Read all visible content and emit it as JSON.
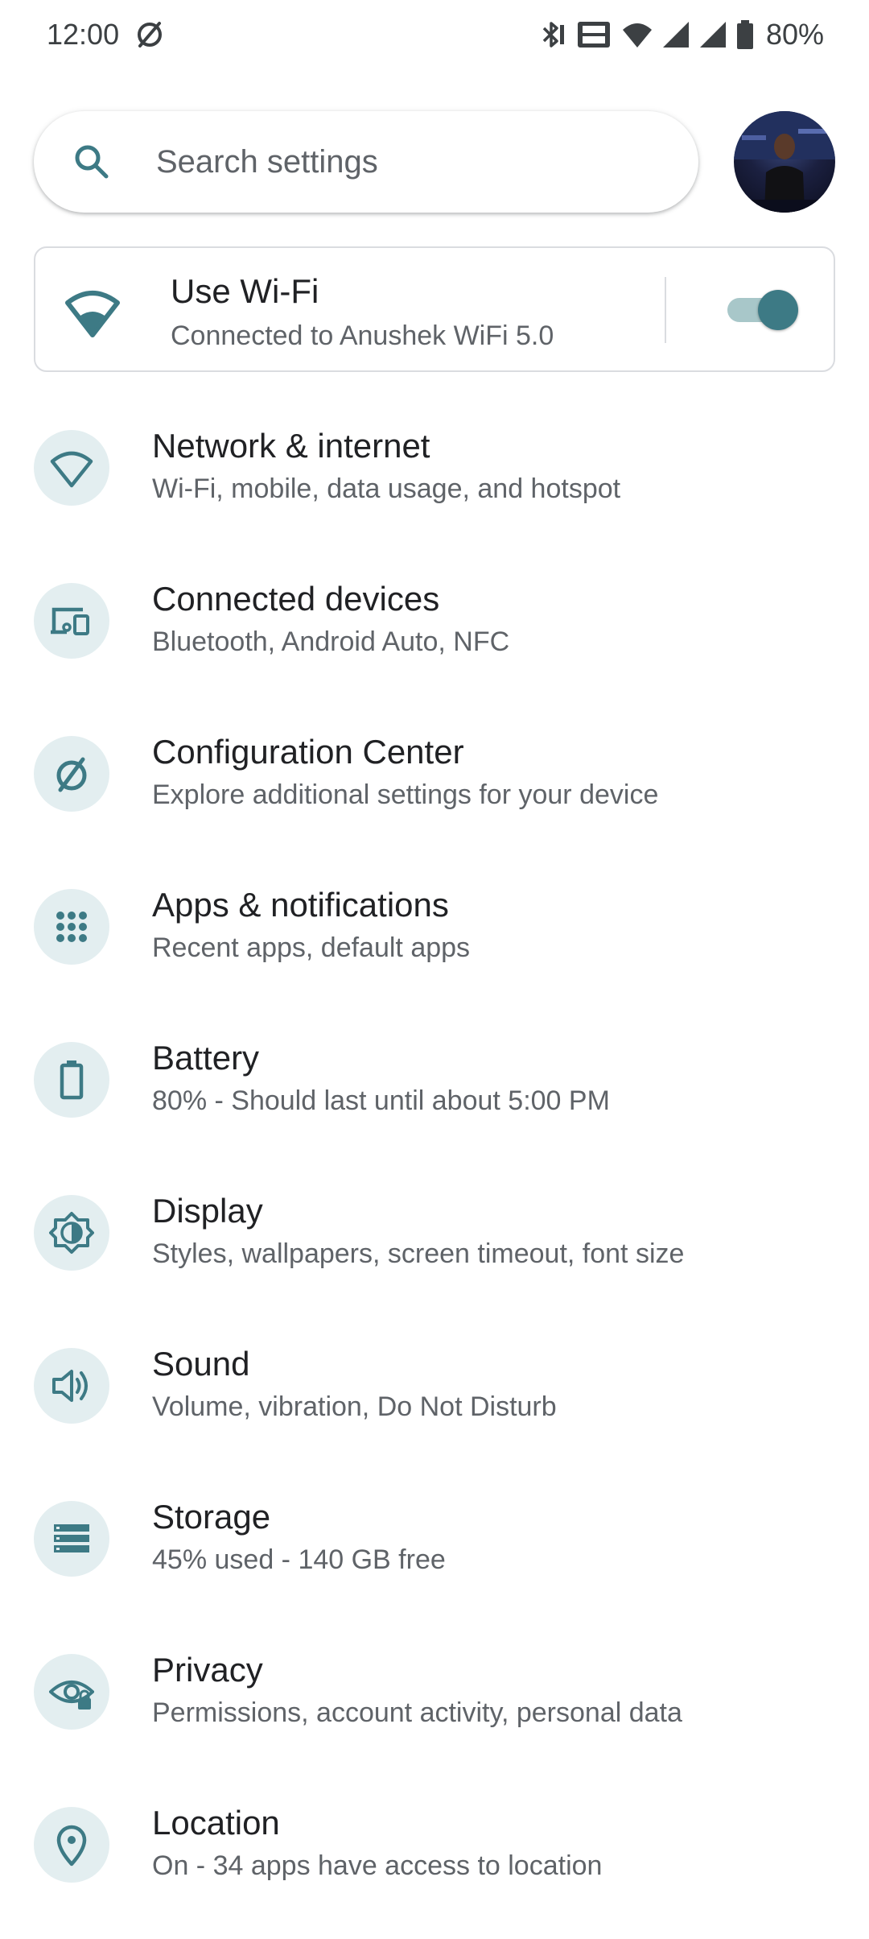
{
  "status_bar": {
    "time": "12:00",
    "battery_percent": "80%",
    "icons": [
      "do-not-disturb-icon",
      "bluetooth-icon",
      "vowifi-icon",
      "wifi-icon",
      "signal-icon",
      "signal-icon",
      "battery-icon"
    ]
  },
  "search": {
    "placeholder": "Search settings"
  },
  "wifi_card": {
    "title": "Use Wi-Fi",
    "summary": "Connected to Anushek WiFi 5.0",
    "enabled": true
  },
  "colors": {
    "accent": "#3d7a85",
    "icon_bg": "#e3eef0",
    "title_text": "#202124",
    "summary_text": "#5f6368"
  },
  "items": [
    {
      "icon": "wifi-icon",
      "title": "Network & internet",
      "summary": "Wi-Fi, mobile, data usage, and hotspot"
    },
    {
      "icon": "devices-icon",
      "title": "Connected devices",
      "summary": "Bluetooth, Android Auto, NFC"
    },
    {
      "icon": "configuration-icon",
      "title": "Configuration Center",
      "summary": "Explore additional settings for your device"
    },
    {
      "icon": "apps-grid-icon",
      "title": "Apps & notifications",
      "summary": "Recent apps, default apps"
    },
    {
      "icon": "battery-icon",
      "title": "Battery",
      "summary": "80% - Should last until about 5:00 PM"
    },
    {
      "icon": "brightness-icon",
      "title": "Display",
      "summary": "Styles, wallpapers, screen timeout, font size"
    },
    {
      "icon": "volume-icon",
      "title": "Sound",
      "summary": "Volume, vibration, Do Not Disturb"
    },
    {
      "icon": "storage-icon",
      "title": "Storage",
      "summary": "45% used - 140 GB free"
    },
    {
      "icon": "privacy-eye-icon",
      "title": "Privacy",
      "summary": "Permissions, account activity, personal data"
    },
    {
      "icon": "location-pin-icon",
      "title": "Location",
      "summary": "On - 34 apps have access to location"
    }
  ]
}
